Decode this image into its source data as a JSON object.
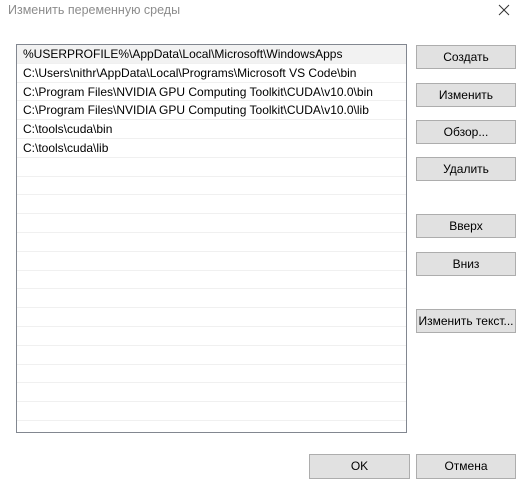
{
  "window": {
    "title": "Изменить переменную среды"
  },
  "list": {
    "items": [
      "%USERPROFILE%\\AppData\\Local\\Microsoft\\WindowsApps",
      "C:\\Users\\nithr\\AppData\\Local\\Programs\\Microsoft VS Code\\bin",
      "C:\\Program Files\\NVIDIA GPU Computing Toolkit\\CUDA\\v10.0\\bin",
      "C:\\Program Files\\NVIDIA GPU Computing Toolkit\\CUDA\\v10.0\\lib",
      "C:\\tools\\cuda\\bin",
      "C:\\tools\\cuda\\lib"
    ],
    "selected_index": 0
  },
  "buttons": {
    "create": "Создать",
    "edit": "Изменить",
    "browse": "Обзор...",
    "delete": "Удалить",
    "up": "Вверх",
    "down": "Вниз",
    "edit_text": "Изменить текст...",
    "ok": "OK",
    "cancel": "Отмена"
  },
  "icons": {
    "close": "close-icon"
  }
}
